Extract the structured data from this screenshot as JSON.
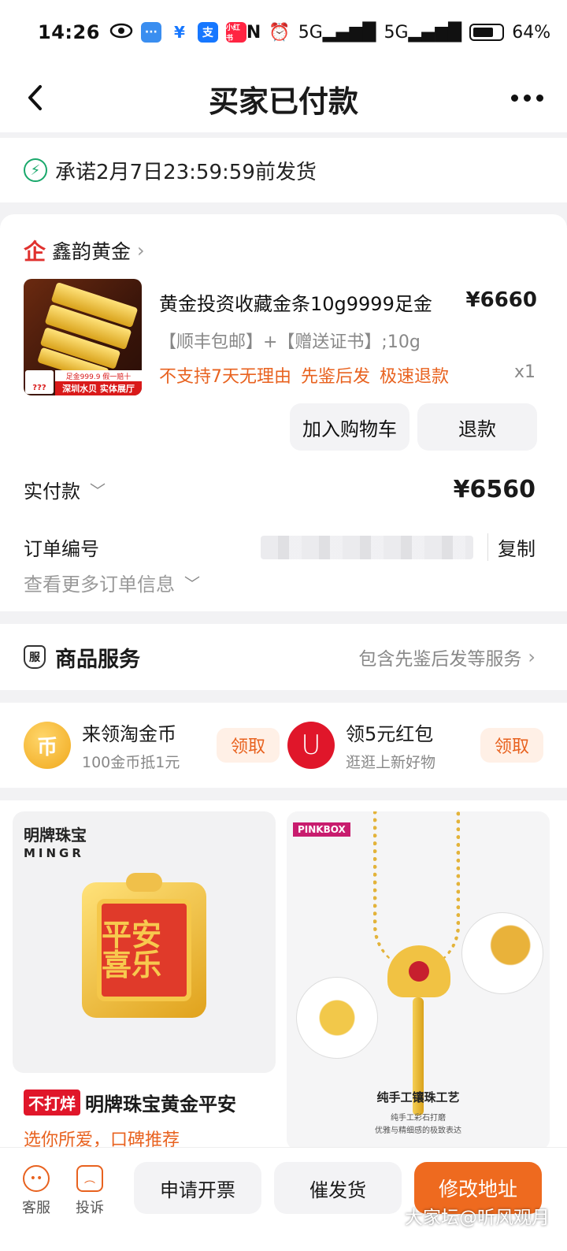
{
  "status_bar": {
    "time": "14:26",
    "network": "5G",
    "battery": "64%",
    "app_icons": [
      "eye-icon",
      "message-icon",
      "yen-icon",
      "alipay-icon",
      "xiaohongshu-icon"
    ]
  },
  "nav": {
    "title": "买家已付款",
    "back_icon": "chevron-left-icon",
    "more_icon": "more-icon"
  },
  "shipping": {
    "text": "承诺2月7日23:59:59前发货"
  },
  "shop": {
    "logo": "企",
    "name": "鑫韵黄金"
  },
  "product": {
    "title": "黄金投资收藏金条10g9999足金",
    "price": "¥6660",
    "spec": "【顺丰包邮】+【赠送证书】;10g",
    "tags": [
      "不支持7天无理由",
      "先鉴后发",
      "极速退款"
    ],
    "qty": "x1",
    "thumb_ribbon": "深圳水贝 实体展厅",
    "thumb_ribbon2": "足金999.9 假一赔十",
    "thumb_tag": "???"
  },
  "actions": {
    "add_cart": "加入购物车",
    "refund": "退款"
  },
  "payment": {
    "label": "实付款",
    "value": "¥6560"
  },
  "order_no": {
    "label": "订单编号",
    "copy": "复制"
  },
  "more_info": "查看更多订单信息",
  "service": {
    "icon_text": "服",
    "title": "商品服务",
    "desc": "包含先鉴后发等服务"
  },
  "rewards": [
    {
      "icon": "币",
      "title": "来领淘金币",
      "sub": "100金币抵1元",
      "button": "领取"
    },
    {
      "icon": "U",
      "title": "领5元红包",
      "sub": "逛逛上新好物",
      "button": "领取"
    }
  ],
  "feed": {
    "left": {
      "brand": "明牌珠宝",
      "brand_en": "MINGR",
      "pendant_text": "平安喜乐",
      "badge": "不打烊",
      "title": "明牌珠宝黄金平安",
      "sub": "选你所爱，口碑推荐"
    },
    "right": {
      "brand": "PINKBOX",
      "craft": "纯手工镶珠工艺",
      "craft_sub1": "纯手工彩石打磨",
      "craft_sub2": "优雅与精细感的极致表达"
    }
  },
  "bottom_bar": {
    "customer_service": "客服",
    "complain": "投诉",
    "invoice": "申请开票",
    "urge": "催发货",
    "change_address": "修改地址"
  },
  "watermark": "大家坛@听风观月",
  "colors": {
    "accent_orange": "#e8621f",
    "primary_button": "#ee6a1f",
    "brand_red": "#e0312e",
    "ship_green": "#19a86b"
  }
}
